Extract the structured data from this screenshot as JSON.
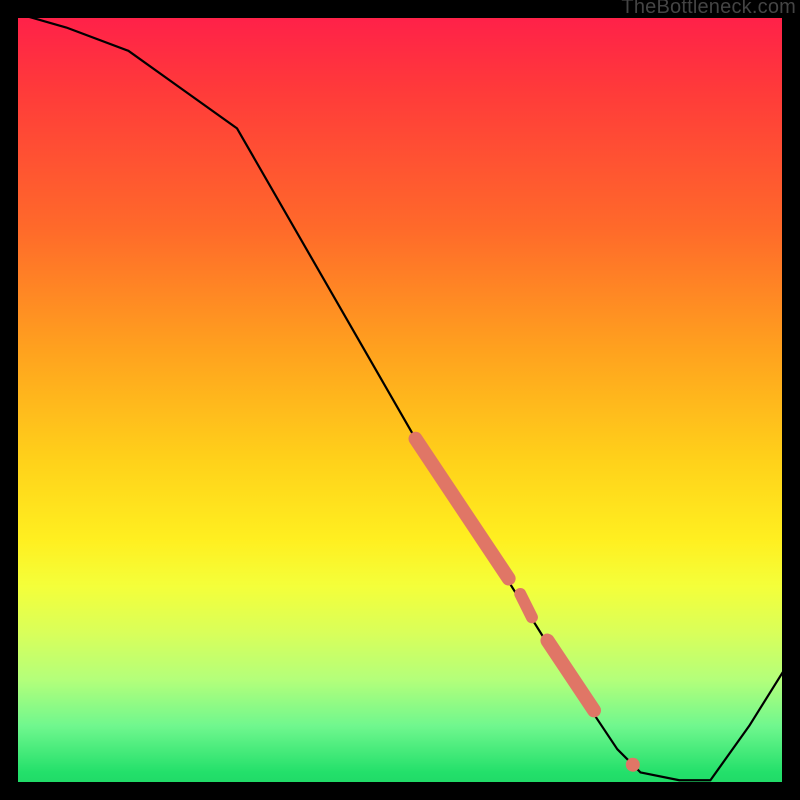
{
  "watermark": "TheBottleneck.com",
  "chart_data": {
    "type": "line",
    "title": "",
    "xlabel": "",
    "ylabel": "",
    "xlim": [
      0,
      100
    ],
    "ylim": [
      0,
      100
    ],
    "grid": false,
    "legend": false,
    "series": [
      {
        "name": "curve",
        "style": "thin-black",
        "x": [
          0,
          7,
          15,
          22,
          29,
          52,
          60,
          70,
          78,
          81,
          86,
          90,
          95,
          100
        ],
        "y": [
          100,
          98,
          95,
          90,
          85,
          45,
          33,
          17,
          5,
          2,
          1,
          1,
          8,
          16
        ]
      },
      {
        "name": "highlight-segment-1",
        "style": "thick-salmon",
        "x": [
          52,
          64
        ],
        "y": [
          45,
          27
        ]
      },
      {
        "name": "highlight-dot-1",
        "style": "thick-salmon-short",
        "x": [
          65.5,
          67
        ],
        "y": [
          25,
          22
        ]
      },
      {
        "name": "highlight-segment-2",
        "style": "thick-salmon",
        "x": [
          69,
          75
        ],
        "y": [
          19,
          10
        ]
      },
      {
        "name": "highlight-dot-2",
        "style": "thick-salmon-dot",
        "x": [
          80
        ],
        "y": [
          3
        ]
      }
    ],
    "colors": {
      "curve": "#000000",
      "highlight": "#e07666"
    }
  }
}
